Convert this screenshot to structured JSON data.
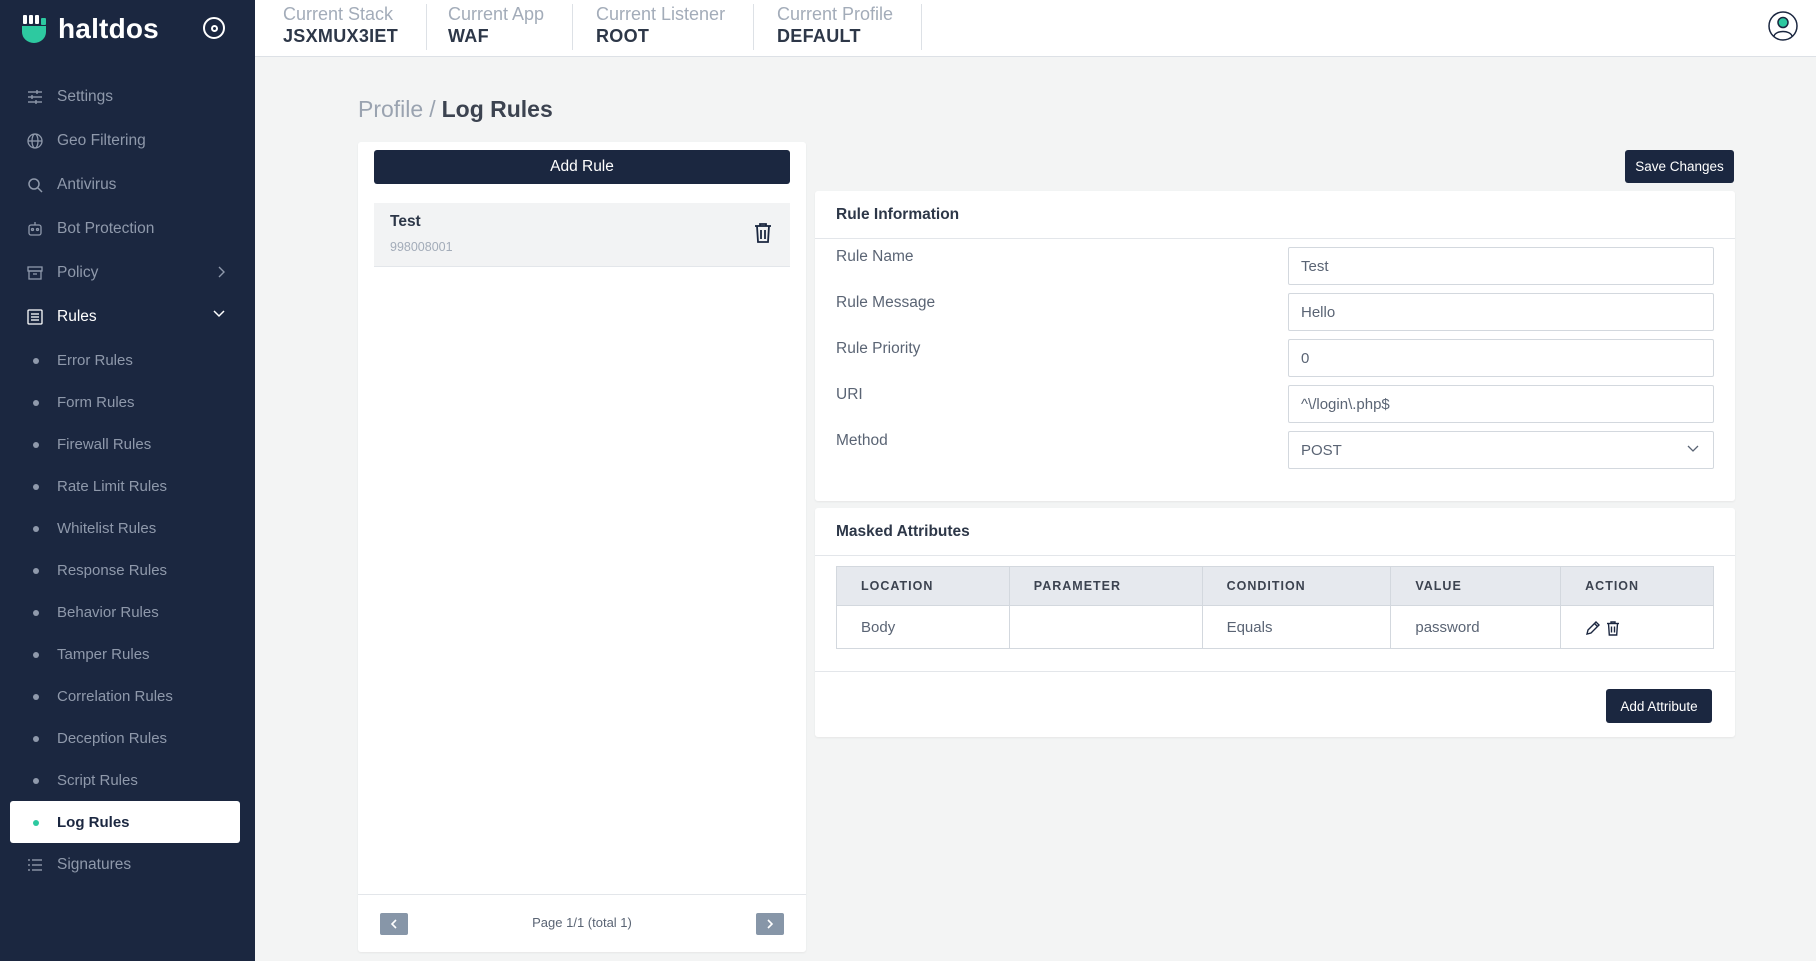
{
  "brand": {
    "name": "haltdos"
  },
  "colors": {
    "sidebar": "#1b2740",
    "accent": "#2dc9a0",
    "button": "#1b2740"
  },
  "sidebar": {
    "items": [
      {
        "label": "Settings",
        "icon": "sliders-icon"
      },
      {
        "label": "Geo Filtering",
        "icon": "globe-icon"
      },
      {
        "label": "Antivirus",
        "icon": "search-icon"
      },
      {
        "label": "Bot Protection",
        "icon": "robot-icon"
      },
      {
        "label": "Policy",
        "icon": "archive-icon"
      },
      {
        "label": "Rules",
        "icon": "list-icon"
      }
    ],
    "rules_sub": [
      "Error Rules",
      "Form Rules",
      "Firewall Rules",
      "Rate Limit Rules",
      "Whitelist Rules",
      "Response Rules",
      "Behavior Rules",
      "Tamper Rules",
      "Correlation Rules",
      "Deception Rules",
      "Script Rules",
      "Log Rules"
    ],
    "signatures": {
      "label": "Signatures",
      "icon": "list-icon"
    }
  },
  "topbar": {
    "stack": {
      "label": "Current Stack",
      "value": "JSXMUX3IET"
    },
    "app": {
      "label": "Current App",
      "value": "WAF"
    },
    "listener": {
      "label": "Current Listener",
      "value": "ROOT"
    },
    "profile": {
      "label": "Current Profile",
      "value": "DEFAULT"
    }
  },
  "breadcrumb": {
    "parent": "Profile",
    "separator": "/",
    "current": "Log Rules"
  },
  "rules_panel": {
    "add_label": "Add Rule",
    "items": [
      {
        "title": "Test",
        "id": "998008001"
      }
    ],
    "pager": {
      "text": "Page 1/1 (total 1)"
    }
  },
  "save_label": "Save Changes",
  "rule_info": {
    "title": "Rule Information",
    "fields": [
      {
        "label": "Rule Name",
        "value": "Test"
      },
      {
        "label": "Rule Message",
        "value": "Hello"
      },
      {
        "label": "Rule Priority",
        "value": "0"
      },
      {
        "label": "URI",
        "value": "^\\/login\\.php$"
      },
      {
        "label": "Method",
        "value": "POST"
      }
    ]
  },
  "masked": {
    "title": "Masked Attributes",
    "columns": [
      "LOCATION",
      "PARAMETER",
      "CONDITION",
      "VALUE",
      "ACTION"
    ],
    "rows": [
      {
        "location": "Body",
        "parameter": "",
        "condition": "Equals",
        "value": "password"
      }
    ],
    "add_label": "Add Attribute"
  }
}
